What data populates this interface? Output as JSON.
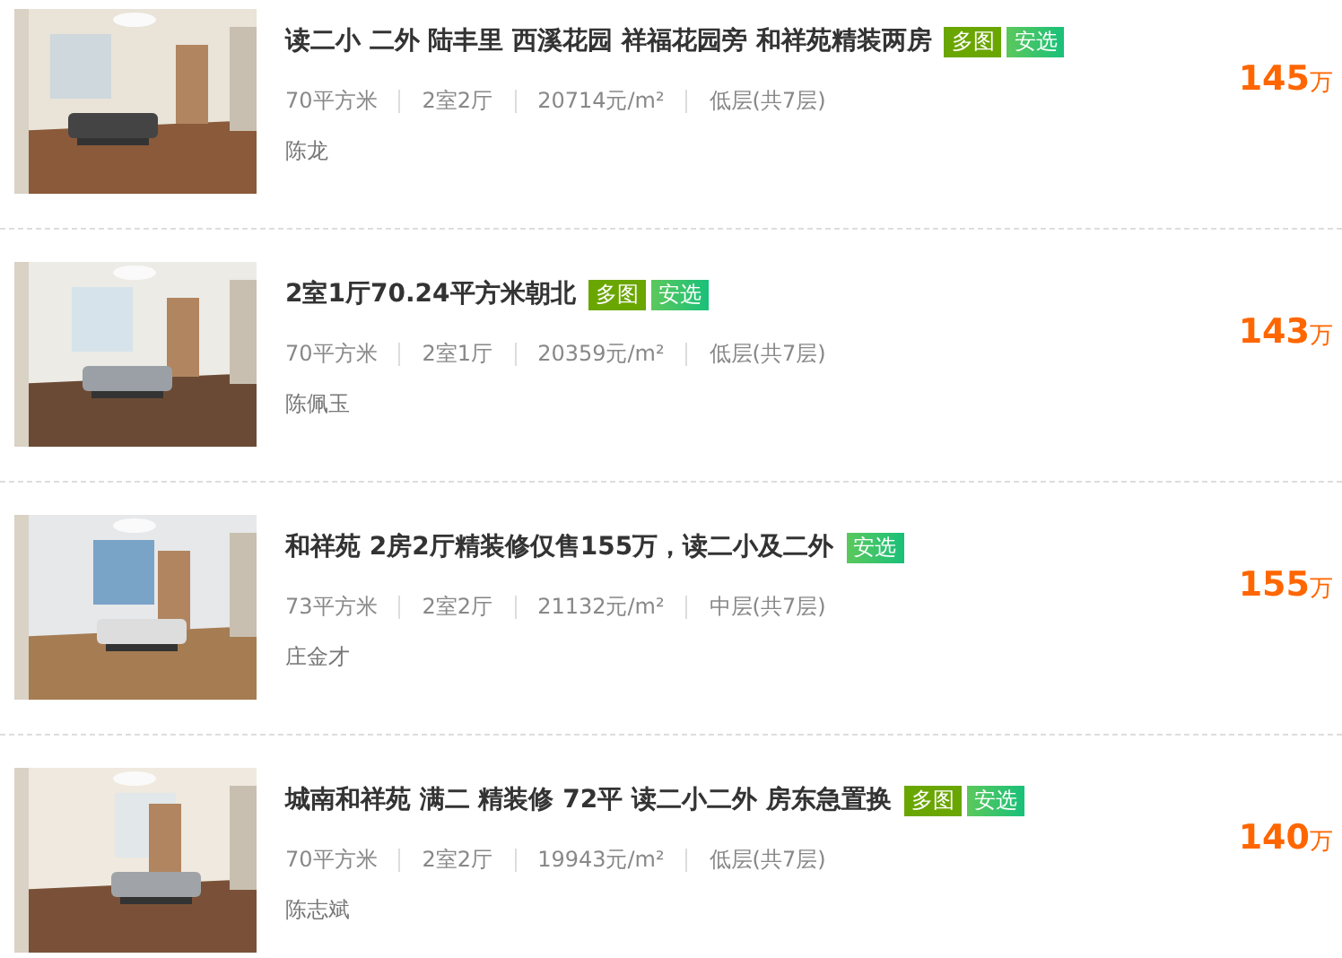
{
  "listings": [
    {
      "image": {
        "kind": "picture"
      },
      "title": "读二小 二外 陆丰里 西溪花园 祥福花园旁 和祥苑精装两房",
      "tags": [
        {
          "kind": "photos",
          "label": "多图"
        },
        {
          "kind": "verified",
          "label": "安选"
        }
      ],
      "stats": [
        "70平方米",
        "2室2厅",
        "20714元/m²",
        "低层(共7层)"
      ],
      "agent": "陈龙",
      "price": "145",
      "unit": "万"
    },
    {
      "image": {
        "kind": "picture"
      },
      "title": "2室1厅70.24平方米朝北",
      "tags": [
        {
          "kind": "photos",
          "label": "多图"
        },
        {
          "kind": "verified",
          "label": "安选"
        }
      ],
      "stats": [
        "70平方米",
        "2室1厅",
        "20359元/m²",
        "低层(共7层)"
      ],
      "agent": "陈佩玉",
      "price": "143",
      "unit": "万"
    },
    {
      "image": {
        "kind": "picture"
      },
      "title": "和祥苑 2房2厅精装修仅售155万，读二小及二外",
      "tags": [
        {
          "kind": "verified",
          "label": "安选"
        }
      ],
      "stats": [
        "73平方米",
        "2室2厅",
        "21132元/m²",
        "中层(共7层)"
      ],
      "agent": "庄金才",
      "price": "155",
      "unit": "万"
    },
    {
      "image": {
        "kind": "picture"
      },
      "title": "城南和祥苑 满二 精装修 72平 读二小二外 房东急置换",
      "tags": [
        {
          "kind": "photos",
          "label": "多图"
        },
        {
          "kind": "verified",
          "label": "安选"
        }
      ],
      "stats": [
        "70平方米",
        "2室2厅",
        "19943元/m²",
        "低层(共7层)"
      ],
      "agent": "陈志斌",
      "price": "140",
      "unit": "万"
    }
  ]
}
